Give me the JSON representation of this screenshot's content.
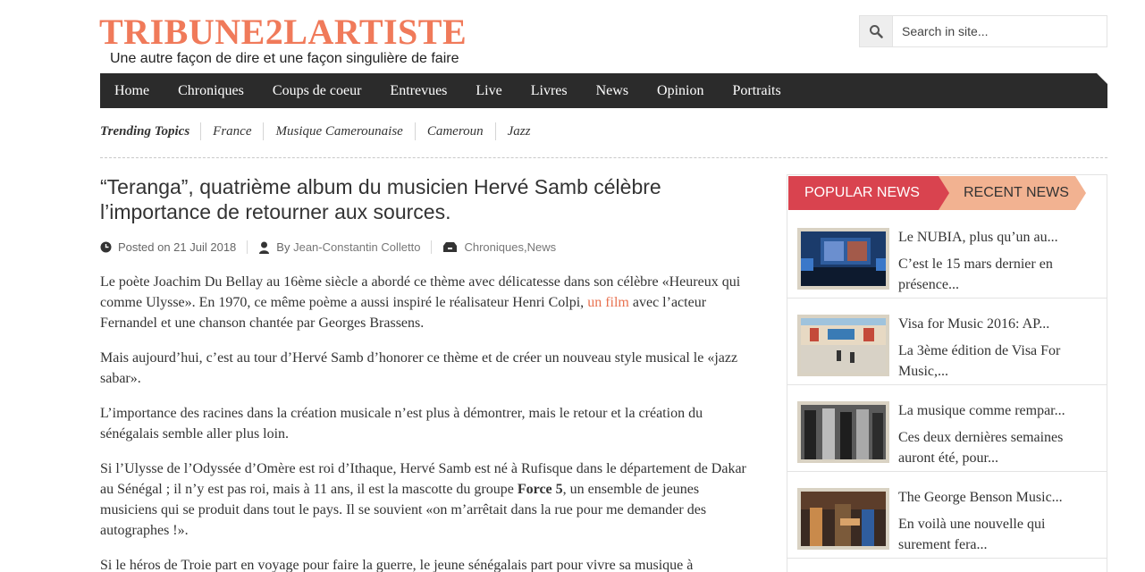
{
  "header": {
    "logo": "TRIBUNE2LARTISTE",
    "tagline": "Une autre façon de dire et une façon singulière de faire"
  },
  "search": {
    "placeholder": "Search in site..."
  },
  "nav": {
    "items": [
      "Home",
      "Chroniques",
      "Coups de coeur",
      "Entrevues",
      "Live",
      "Livres",
      "News",
      "Opinion",
      "Portraits"
    ]
  },
  "trending": {
    "title": "Trending Topics",
    "items": [
      "France",
      "Musique Camerounaise",
      "Cameroun",
      "Jazz"
    ]
  },
  "article": {
    "title": "“Teranga”, quatrième album du musicien Hervé Samb célèbre l’importance de retourner aux sources.",
    "meta": {
      "posted_prefix": "Posted on",
      "date": "21 Juil 2018",
      "by_prefix": "By",
      "author": "Jean-Constantin Colletto",
      "cat1": "Chroniques",
      "sep": ", ",
      "cat2": "News"
    },
    "p1_a": "Le poète Joachim Du Bellay au 16ème siècle a abordé ce thème avec délicatesse dans son célèbre «Heureux qui comme Ulysse». En 1970, ce même poème a aussi inspiré le réalisateur Henri Colpi, ",
    "p1_link": "un film",
    "p1_b": " avec l’acteur Fernandel et une chanson chantée par Georges Brassens.",
    "p2": "Mais aujourd’hui, c’est au tour d’Hervé Samb d’honorer ce thème et de créer un nouveau style musical le «jazz sabar».",
    "p3": "L’importance des racines dans la création musicale n’est plus à démontrer, mais le retour et la création du sénégalais semble aller plus loin.",
    "p4_a": "Si l’Ulysse de l’Odyssée d’Omère est roi d’Ithaque, Hervé Samb est né à Rufisque dans le département de Dakar au Sénégal ; il n’y est pas roi, mais à 11 ans, il est la mascotte du groupe ",
    "p4_bold": "Force 5",
    "p4_b": ", un ensemble de jeunes musiciens qui se produit dans tout le pays. Il se souvient «on m’arrêtait dans la rue pour me demander des autographes !».",
    "p5": "Si le héros de Troie part en voyage pour faire la guerre, le jeune sénégalais part pour vivre sa musique à"
  },
  "sidebar": {
    "tab_popular": "POPULAR NEWS",
    "tab_recent": "RECENT NEWS",
    "news": [
      {
        "title": "Le NUBIA, plus qu’un au...",
        "excerpt": "C’est le 15 mars dernier en présence..."
      },
      {
        "title": "Visa for Music 2016: AP...",
        "excerpt": "La 3ème édition de Visa For Music,..."
      },
      {
        "title": "La musique comme rempar...",
        "excerpt": "Ces deux dernières semaines auront été, pour..."
      },
      {
        "title": "The George Benson Music...",
        "excerpt": "En voilà une nouvelle qui surement fera..."
      }
    ]
  },
  "colors": {
    "brand": "#f07a5a",
    "nav_bg": "#2b2b2b",
    "tab_popular": "#d9434f",
    "tab_recent": "#f2b291"
  },
  "icons": [
    "search-icon",
    "clock-icon",
    "user-icon",
    "folder-icon"
  ]
}
